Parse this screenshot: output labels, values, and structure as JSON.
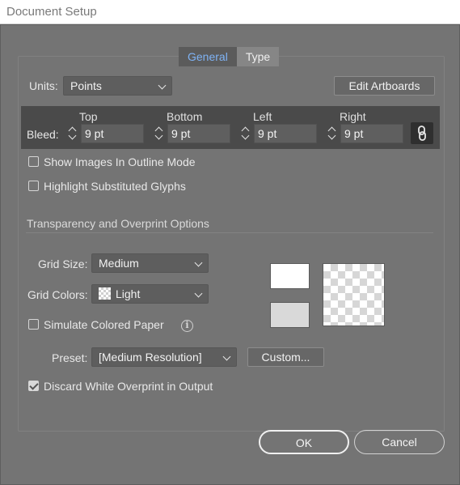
{
  "window": {
    "title": "Document Setup"
  },
  "tabs": [
    {
      "label": "General",
      "active": true
    },
    {
      "label": "Type",
      "active": false
    }
  ],
  "units": {
    "label": "Units:",
    "value": "Points"
  },
  "edit_artboards_label": "Edit Artboards",
  "bleed": {
    "label": "Bleed:",
    "fields": [
      {
        "header": "Top",
        "value": "9 pt"
      },
      {
        "header": "Bottom",
        "value": "9 pt"
      },
      {
        "header": "Left",
        "value": "9 pt"
      },
      {
        "header": "Right",
        "value": "9 pt"
      }
    ],
    "link_icon": "chain-link-icon"
  },
  "options": {
    "show_images_outline": {
      "label": "Show Images In Outline Mode",
      "checked": false
    },
    "highlight_glyphs": {
      "label": "Highlight Substituted Glyphs",
      "checked": false
    }
  },
  "transparency": {
    "section_title": "Transparency and Overprint Options",
    "grid_size": {
      "label": "Grid Size:",
      "value": "Medium"
    },
    "grid_colors": {
      "label": "Grid Colors:",
      "value": "Light"
    },
    "simulate_paper": {
      "label": "Simulate Colored Paper",
      "checked": false
    },
    "preset": {
      "label": "Preset:",
      "value": "[Medium Resolution]"
    },
    "custom_label": "Custom...",
    "discard_white": {
      "label": "Discard White Overprint in Output",
      "checked": true
    },
    "swatch_colors": {
      "top": "#ffffff",
      "bottom": "#d9d9d9"
    }
  },
  "footer": {
    "ok_label": "OK",
    "cancel_label": "Cancel"
  },
  "colors": {
    "active_tab_text": "#7fb3f5",
    "dialog_bg": "#747474",
    "bleed_bar": "#4a4a4a"
  }
}
